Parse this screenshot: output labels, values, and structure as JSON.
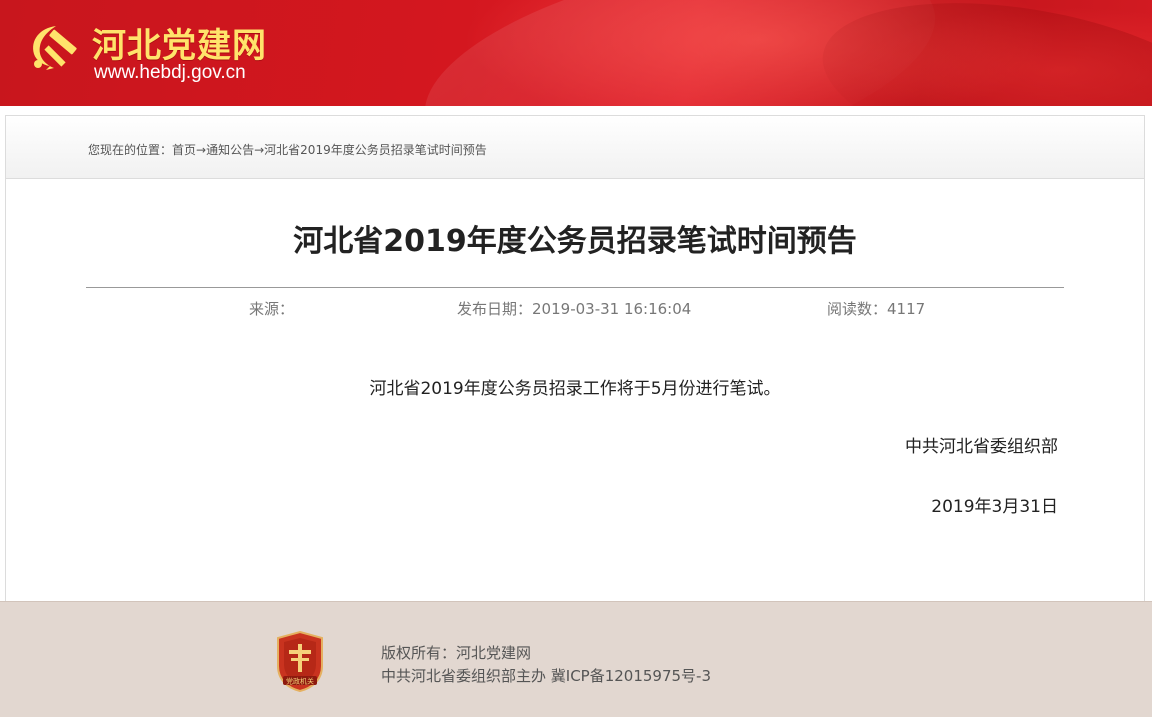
{
  "header": {
    "site_name": "河北党建网",
    "site_url": "www.hebdj.gov.cn",
    "emblem_icon": "hammer-sickle-icon",
    "colors": {
      "brand_red": "#d4171f",
      "logo_yellow": "#ffe36b"
    }
  },
  "breadcrumb": {
    "label": "您现在的位置：",
    "items": [
      "首页",
      "通知公告",
      "河北省2019年度公务员招录笔试时间预告"
    ],
    "separator": "→"
  },
  "article": {
    "title": "河北省2019年度公务员招录笔试时间预告",
    "source_label": "来源：",
    "source_value": "",
    "date_label": "发布日期：",
    "date_value": "2019-03-31 16:16:04",
    "views_label": "阅读数：",
    "views_value": "4117",
    "body": "河北省2019年度公务员招录工作将于5月份进行笔试。",
    "signature_org": "中共河北省委组织部",
    "signature_date": "2019年3月31日"
  },
  "footer": {
    "badge_icon": "party-gov-badge-icon",
    "badge_text": "党政机关",
    "copyright": "版权所有：河北党建网",
    "host_icp": "中共河北省委组织部主办 冀ICP备12015975号-3"
  }
}
